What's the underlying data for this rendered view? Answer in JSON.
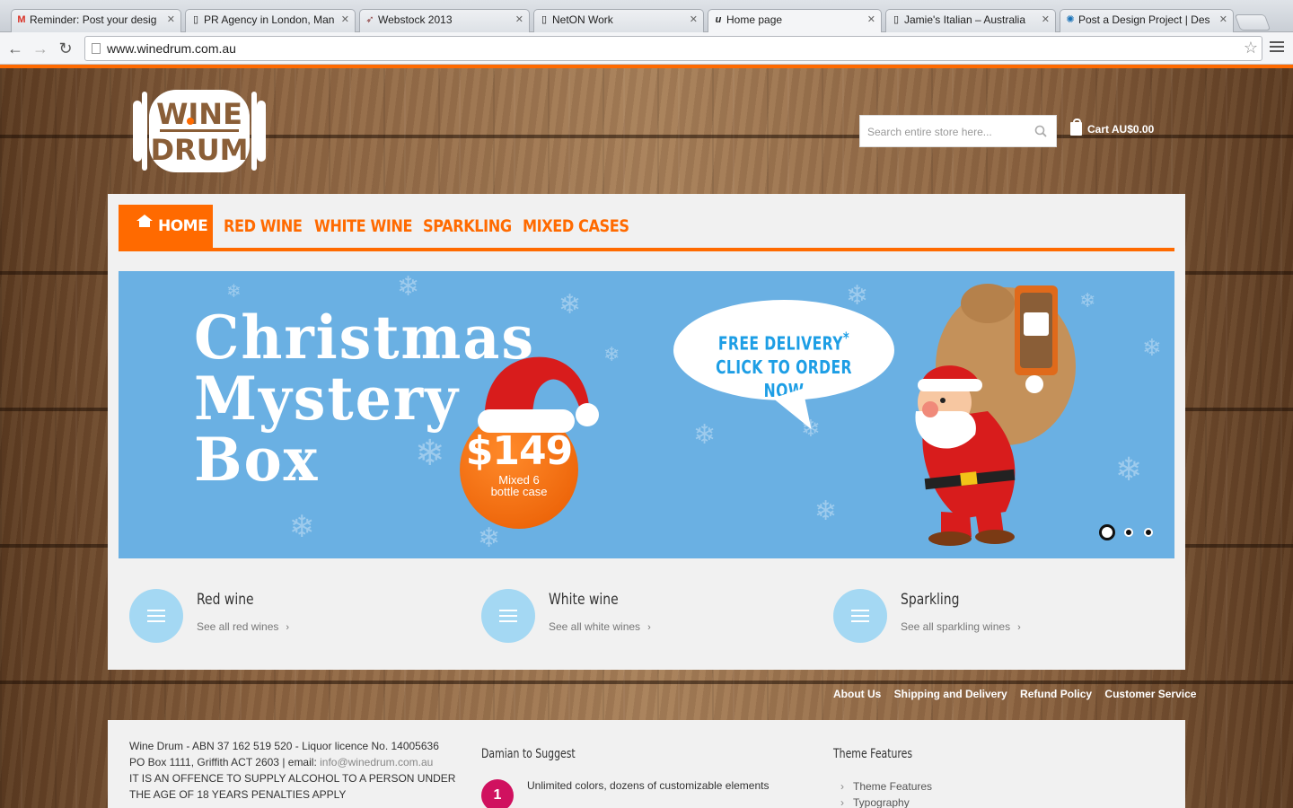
{
  "browser": {
    "tabs": [
      {
        "title": "Reminder: Post your desig",
        "icon": "gmail-icon"
      },
      {
        "title": "PR Agency in London, Man",
        "icon": "page-icon"
      },
      {
        "title": "Webstock 2013",
        "icon": "bird-icon"
      },
      {
        "title": "NetON Work",
        "icon": "page-icon"
      },
      {
        "title": "Home page",
        "icon": "u-icon"
      },
      {
        "title": "Jamie's Italian – Australia",
        "icon": "page-icon"
      },
      {
        "title": "Post a Design Project | Des",
        "icon": "gear-icon"
      }
    ],
    "url": "www.winedrum.com.au"
  },
  "header": {
    "logo_text_top": "WINE",
    "logo_text_bottom": "DRUM",
    "search_placeholder": "Search entire store here...",
    "cart_label": "Cart AU$0.00"
  },
  "nav": {
    "items": [
      "HOME",
      "RED WINE",
      "WHITE WINE",
      "SPARKLING",
      "MIXED CASES"
    ]
  },
  "banner": {
    "title_lines": [
      "Christmas",
      "Mystery",
      "Box"
    ],
    "price": "$149",
    "price_sub_1": "Mixed 6",
    "price_sub_2": "bottle case",
    "bubble_line_1": "FREE DELIVERY",
    "bubble_asterisk": "*",
    "bubble_line_2": "CLICK TO ORDER NOW",
    "slide_count": 3,
    "active_slide": 1
  },
  "categories": [
    {
      "title": "Red wine",
      "link": "See all red wines"
    },
    {
      "title": "White wine",
      "link": "See all white wines"
    },
    {
      "title": "Sparkling",
      "link": "See all sparkling wines"
    }
  ],
  "footer_links": [
    "About Us",
    "Shipping and Delivery",
    "Refund Policy",
    "Customer Service"
  ],
  "footer": {
    "info_line_1": "Wine Drum - ABN 37 162 519 520 - Liquor licence No. 14005636",
    "info_line_2_prefix": "PO Box 1111, Griffith ACT 2603 | email: ",
    "info_email": "info@winedrum.com.au",
    "info_line_3": "IT IS AN OFFENCE TO SUPPLY ALCOHOL TO A PERSON UNDER",
    "info_line_4": "THE AGE OF 18 YEARS PENALTIES APPLY",
    "suggest_heading": "Damian to Suggest",
    "suggest_number": "1",
    "suggest_text": "Unlimited colors, dozens of customizable elements",
    "features_heading": "Theme Features",
    "features": [
      "Theme Features",
      "Typography"
    ]
  },
  "colors": {
    "accent": "#ff6a00",
    "banner_bg": "#6ab0e3",
    "panel_bg": "#f1f1f1",
    "badge": "#d0115f"
  }
}
